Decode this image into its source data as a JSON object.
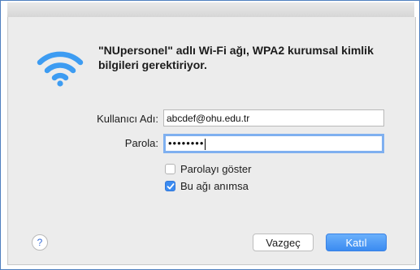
{
  "dialog": {
    "message": "\"NUpersonel\" adlı Wi-Fi ağı, WPA2 kurumsal kimlik bilgileri gerektiriyor.",
    "icon": "wifi-icon"
  },
  "form": {
    "username_label": "Kullanıcı Adı:",
    "username_value": "abcdef@ohu.edu.tr",
    "password_label": "Parola:",
    "password_value": "••••••••",
    "show_password_label": "Parolayı göster",
    "show_password_checked": false,
    "remember_label": "Bu ağı anımsa",
    "remember_checked": true
  },
  "buttons": {
    "help": "?",
    "cancel": "Vazgeç",
    "join": "Katıl"
  },
  "colors": {
    "accent": "#3b8bf1",
    "wifi": "#3d9cf2"
  }
}
